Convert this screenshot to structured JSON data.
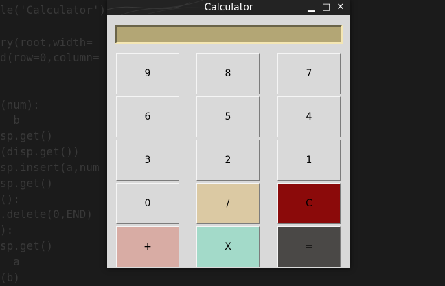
{
  "background_editor": {
    "lines": [
      "le('Calculator')",
      "",
      "ry(root,width=",
      "d(row=0,column=",
      "",
      "",
      "(num):",
      "  b",
      "sp.get()",
      "(disp.get())",
      "sp.insert(a,num",
      "sp.get()",
      "():",
      ".delete(0,END)",
      "):",
      "sp.get()",
      "  a",
      "(b)"
    ]
  },
  "window": {
    "title": "Calculator",
    "controls": {
      "minimize": "▁",
      "maximize": "□",
      "close": "✕"
    }
  },
  "display": {
    "value": ""
  },
  "buttons": [
    {
      "label": "9",
      "name": "button-9",
      "bg": "#d9d9d9"
    },
    {
      "label": "8",
      "name": "button-8",
      "bg": "#d9d9d9"
    },
    {
      "label": "7",
      "name": "button-7",
      "bg": "#d9d9d9"
    },
    {
      "label": "6",
      "name": "button-6",
      "bg": "#d9d9d9"
    },
    {
      "label": "5",
      "name": "button-5",
      "bg": "#d9d9d9"
    },
    {
      "label": "4",
      "name": "button-4",
      "bg": "#d9d9d9"
    },
    {
      "label": "3",
      "name": "button-3",
      "bg": "#d9d9d9"
    },
    {
      "label": "2",
      "name": "button-2",
      "bg": "#d9d9d9"
    },
    {
      "label": "1",
      "name": "button-1",
      "bg": "#d9d9d9"
    },
    {
      "label": "0",
      "name": "button-0",
      "bg": "#d9d9d9"
    },
    {
      "label": "/",
      "name": "divide-button",
      "bg": "#dbc9a3"
    },
    {
      "label": "C",
      "name": "clear-button",
      "bg": "#8b0a0a"
    },
    {
      "label": "+",
      "name": "add-button",
      "bg": "#d8aca4"
    },
    {
      "label": "X",
      "name": "multiply-button",
      "bg": "#a3dac9"
    },
    {
      "label": "=",
      "name": "equals-button",
      "bg": "#4a4846"
    }
  ]
}
